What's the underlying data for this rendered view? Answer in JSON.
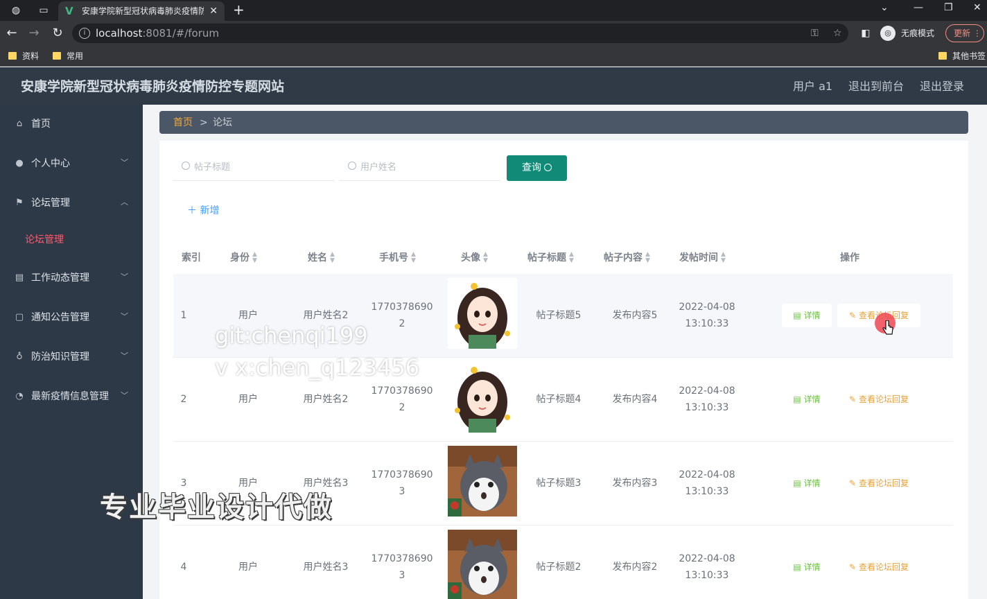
{
  "browser": {
    "tab_title": "安康学院新型冠状病毒肺炎疫情防",
    "url_host": "localhost",
    "url_rest": ":8081/#/forum",
    "incognito_label": "无痕模式",
    "update_label": "更新",
    "bookmarks": [
      "资料",
      "常用"
    ],
    "other_bookmarks": "其他书签"
  },
  "app": {
    "title": "安康学院新型冠状病毒肺炎疫情防控专题网站",
    "user_label": "用户 a1",
    "front_label": "退出到前台",
    "logout_label": "退出登录"
  },
  "sidebar": {
    "items": [
      {
        "label": "首页",
        "icon": "home-icon"
      },
      {
        "label": "个人中心",
        "icon": "user-icon"
      },
      {
        "label": "论坛管理",
        "icon": "flag-icon"
      },
      {
        "label": "论坛管理",
        "icon": ""
      },
      {
        "label": "工作动态管理",
        "icon": "news-icon"
      },
      {
        "label": "通知公告管理",
        "icon": "message-icon"
      },
      {
        "label": "防治知识管理",
        "icon": "mic-icon"
      },
      {
        "label": "最新疫情信息管理",
        "icon": "compass-icon"
      }
    ]
  },
  "breadcrumb": {
    "home": "首页",
    "separator": ">",
    "current": "论坛"
  },
  "search": {
    "title_placeholder": "帖子标题",
    "name_placeholder": "用户姓名",
    "query_label": "查询"
  },
  "add_label": "新增",
  "table": {
    "headers": [
      "索引",
      "身份",
      "姓名",
      "手机号",
      "头像",
      "帖子标题",
      "帖子内容",
      "发帖时间",
      "操作"
    ],
    "detail_label": "详情",
    "reply_label": "查看论坛回复",
    "rows": [
      {
        "index": "1",
        "role": "用户",
        "name": "用户姓名2",
        "phone1": "1770378690",
        "phone2": "2",
        "title": "帖子标题5",
        "content": "发布内容5",
        "date": "2022-04-08",
        "time": "13:10:33",
        "avatar": "girl-avatar"
      },
      {
        "index": "2",
        "role": "用户",
        "name": "用户姓名2",
        "phone1": "1770378690",
        "phone2": "2",
        "title": "帖子标题4",
        "content": "发布内容4",
        "date": "2022-04-08",
        "time": "13:10:33",
        "avatar": "girl-avatar"
      },
      {
        "index": "3",
        "role": "用户",
        "name": "用户姓名3",
        "phone1": "1770378690",
        "phone2": "3",
        "title": "帖子标题3",
        "content": "发布内容3",
        "date": "2022-04-08",
        "time": "13:10:33",
        "avatar": "cat-avatar"
      },
      {
        "index": "4",
        "role": "用户",
        "name": "用户姓名3",
        "phone1": "1770378690",
        "phone2": "3",
        "title": "帖子标题2",
        "content": "发布内容2",
        "date": "2022-04-08",
        "time": "13:10:33",
        "avatar": "cat-avatar"
      }
    ]
  },
  "overlay": {
    "line1": "git:chenqi199",
    "line2": "v x:chen_q123456",
    "banner": "专业毕业设计代做"
  }
}
